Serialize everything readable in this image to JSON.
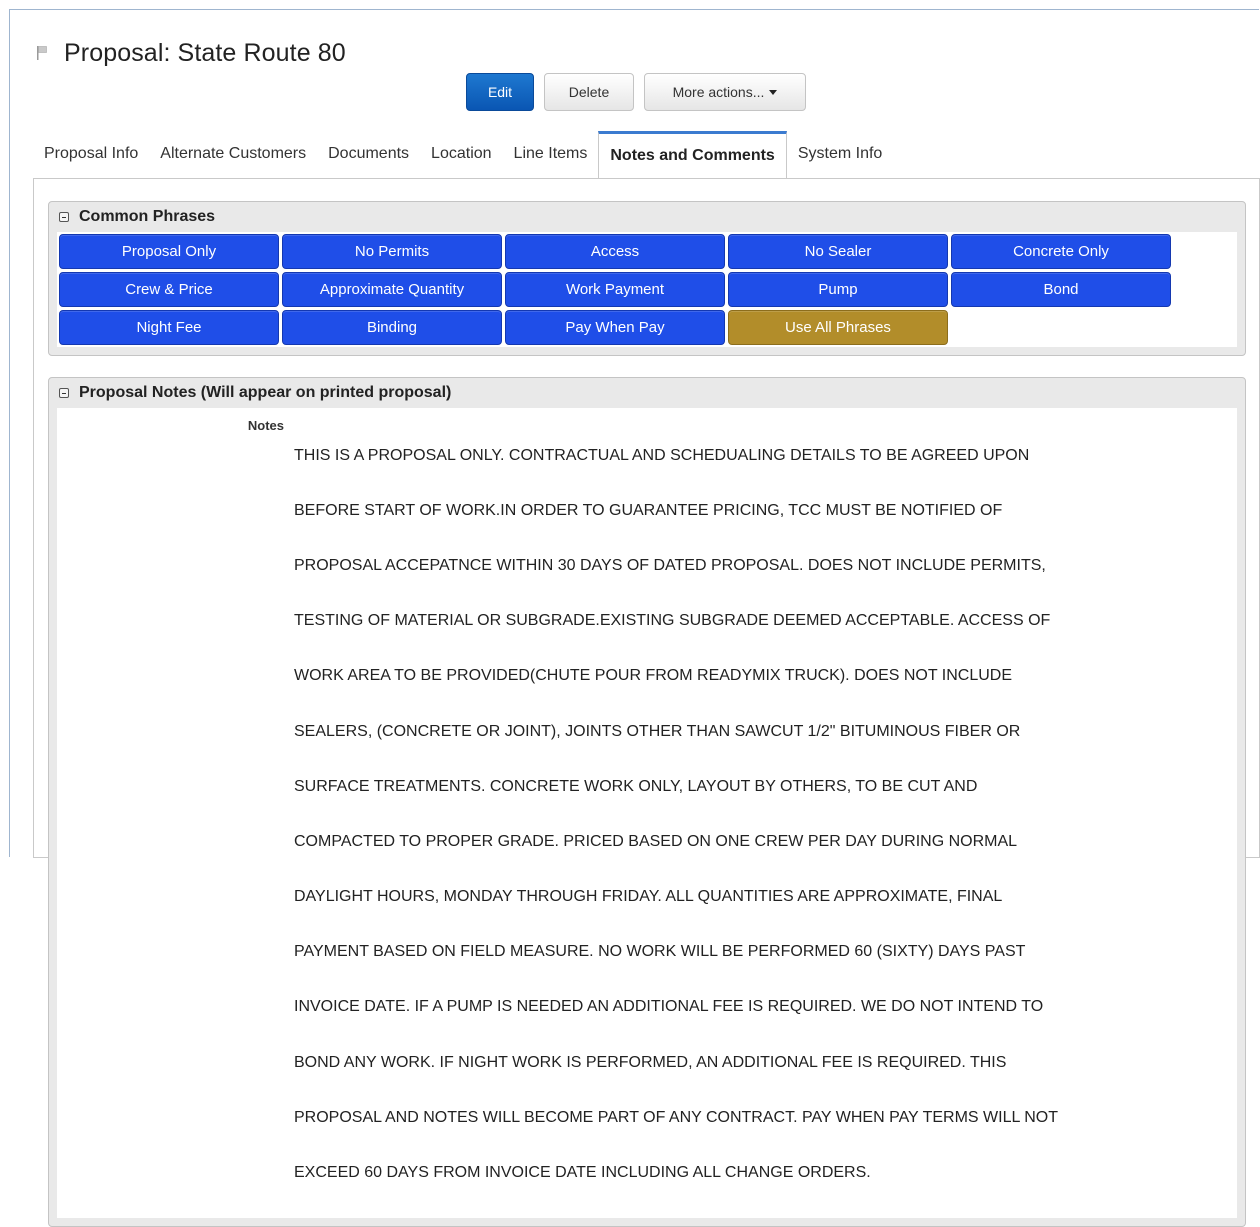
{
  "header": {
    "flag_icon": "flag-icon",
    "title": "Proposal: State Route 80"
  },
  "actions": {
    "edit_label": "Edit",
    "delete_label": "Delete",
    "more_label": "More actions...",
    "more_icon": "caret-down-icon"
  },
  "tabs": [
    {
      "label": "Proposal Info",
      "active": false
    },
    {
      "label": "Alternate Customers",
      "active": false
    },
    {
      "label": "Documents",
      "active": false
    },
    {
      "label": "Location",
      "active": false
    },
    {
      "label": "Line Items",
      "active": false
    },
    {
      "label": "Notes and Comments",
      "active": true
    },
    {
      "label": "System Info",
      "active": false
    }
  ],
  "common_phrases": {
    "title": "Common Phrases",
    "collapse_icon": "collapse-minus-icon",
    "buttons": [
      {
        "label": "Proposal Only",
        "color": "#1f4ee8"
      },
      {
        "label": "No Permits",
        "color": "#1f4ee8"
      },
      {
        "label": "Access",
        "color": "#1f4ee8"
      },
      {
        "label": "No Sealer",
        "color": "#1f4ee8"
      },
      {
        "label": "Concrete Only",
        "color": "#1f4ee8"
      },
      {
        "label": "Crew & Price",
        "color": "#1f4ee8"
      },
      {
        "label": "Approximate Quantity",
        "color": "#1f4ee8"
      },
      {
        "label": "Work Payment",
        "color": "#1f4ee8"
      },
      {
        "label": "Pump",
        "color": "#1f4ee8"
      },
      {
        "label": "Bond",
        "color": "#1f4ee8"
      },
      {
        "label": "Night Fee",
        "color": "#1f4ee8"
      },
      {
        "label": "Binding",
        "color": "#1f4ee8"
      },
      {
        "label": "Pay When Pay",
        "color": "#1f4ee8"
      },
      {
        "label": "Use All Phrases",
        "color": "#b28d2a"
      }
    ]
  },
  "proposal_notes": {
    "title": "Proposal Notes (Will appear on printed proposal)",
    "collapse_icon": "collapse-minus-icon",
    "label": "Notes",
    "lines": [
      "THIS IS A PROPOSAL ONLY. CONTRACTUAL AND SCHEDUALING DETAILS TO BE AGREED UPON",
      "BEFORE START OF WORK.IN ORDER TO GUARANTEE PRICING, TCC MUST BE NOTIFIED OF",
      "PROPOSAL ACCEPATNCE WITHIN 30 DAYS OF DATED PROPOSAL. DOES NOT INCLUDE PERMITS,",
      "TESTING OF MATERIAL OR SUBGRADE.EXISTING SUBGRADE DEEMED ACCEPTABLE. ACCESS OF",
      "WORK AREA TO BE PROVIDED(CHUTE POUR FROM READYMIX TRUCK). DOES NOT INCLUDE",
      "SEALERS, (CONCRETE OR JOINT), JOINTS OTHER THAN SAWCUT 1/2\" BITUMINOUS FIBER OR",
      "SURFACE TREATMENTS. CONCRETE WORK ONLY, LAYOUT BY OTHERS, TO BE CUT AND",
      "COMPACTED TO PROPER GRADE. PRICED BASED ON ONE CREW PER DAY DURING NORMAL",
      "DAYLIGHT HOURS, MONDAY THROUGH FRIDAY. ALL QUANTITIES ARE APPROXIMATE, FINAL",
      "PAYMENT BASED ON FIELD MEASURE. NO WORK WILL BE PERFORMED 60 (SIXTY) DAYS PAST",
      "INVOICE DATE. IF A PUMP IS NEEDED AN ADDITIONAL FEE IS REQUIRED. WE DO NOT INTEND TO",
      "BOND ANY WORK. IF NIGHT WORK IS PERFORMED, AN ADDITIONAL FEE IS REQUIRED. THIS",
      "PROPOSAL AND NOTES WILL BECOME PART OF ANY CONTRACT. PAY WHEN PAY TERMS WILL NOT",
      "EXCEED 60 DAYS FROM INVOICE DATE INCLUDING ALL CHANGE ORDERS."
    ]
  }
}
